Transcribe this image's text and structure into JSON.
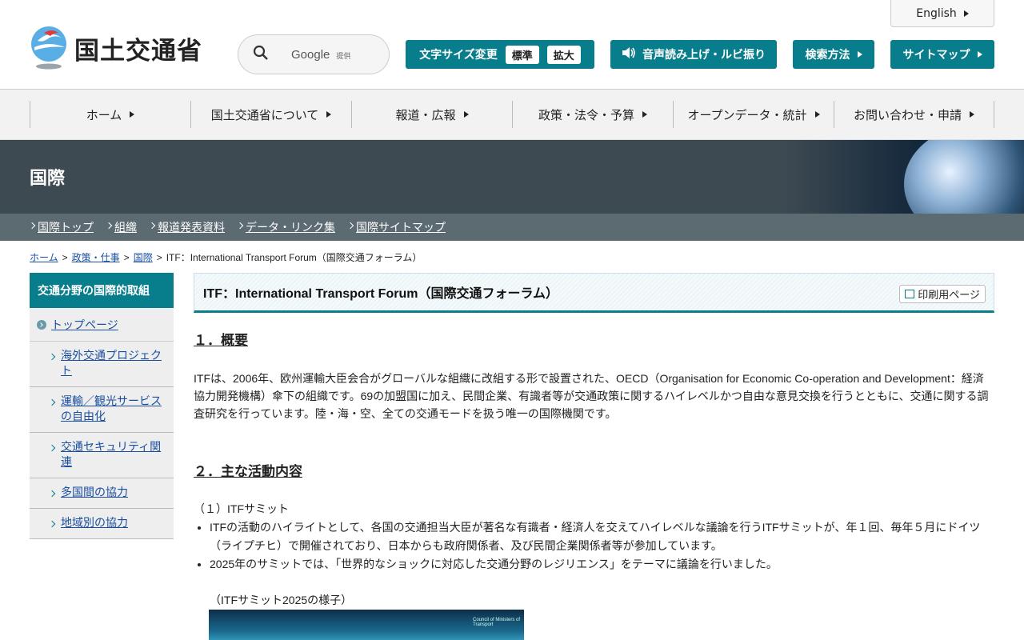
{
  "header": {
    "logo_text": "国土交通省",
    "search_brand": "Google",
    "search_suffix": "提供",
    "fontsize_label": "文字サイズ変更",
    "fontsize_normal": "標準",
    "fontsize_large": "拡大",
    "speech_label": "音声読み上げ・ルビ振り",
    "search_method": "検索方法",
    "sitemap": "サイトマップ",
    "english": "English"
  },
  "gnav": [
    {
      "label": "ホーム"
    },
    {
      "label": "国土交通省について"
    },
    {
      "label": "報道・広報"
    },
    {
      "label": "政策・法令・予算"
    },
    {
      "label": "オープンデータ・統計"
    },
    {
      "label": "お問い合わせ・申請"
    }
  ],
  "banner": {
    "title": "国際"
  },
  "subnav": [
    {
      "label": "国際トップ"
    },
    {
      "label": "組織"
    },
    {
      "label": "報道発表資料"
    },
    {
      "label": "データ・リンク集"
    },
    {
      "label": "国際サイトマップ"
    }
  ],
  "breadcrumb": {
    "home": "ホーム",
    "policy": "政策・仕事",
    "intl": "国際",
    "current": "ITF：International Transport Forum（国際交通フォーラム）",
    "sep": ">"
  },
  "sidebar": {
    "heading": "交通分野の国際的取組",
    "top": "トップページ",
    "items": [
      {
        "label": "海外交通プロジェクト"
      },
      {
        "label": "運輸／観光サービスの自由化"
      },
      {
        "label": "交通セキュリティ関連"
      },
      {
        "label": "多国間の協力"
      },
      {
        "label": "地域別の協力"
      }
    ]
  },
  "main": {
    "title": "ITF：International Transport Forum（国際交通フォーラム）",
    "print_label": "印刷用ページ",
    "section1": "１．概要",
    "overview": "ITFは、2006年、欧州運輸大臣会合がグローバルな組織に改組する形で設置された、OECD（Organisation for Economic Co-operation and Development：経済協力開発機構）傘下の組織です。69の加盟国に加え、民間企業、有識者等が交通政策に関するハイレベルかつ自由な意見交換を行うとともに、交通に関する調査研究を行っています。陸・海・空、全ての交通モードを扱う唯一の国際機関です。",
    "section2": "２．主な活動内容",
    "summit_head": "（１）ITFサミット",
    "bullets": [
      "ITFの活動のハイライトとして、各国の交通担当大臣が著名な有識者・経済人を交えてハイレベルな議論を行うITFサミットが、年１回、毎年５月にドイツ（ライプチヒ）で開催されており、日本からも政府関係者、及び民間企業関係者等が参加しています。",
      "2025年のサミットでは、「世界的なショックに対応した交通分野のレジリエンス」をテーマに議論を行いました。"
    ],
    "photo_caption": "（ITFサミット2025の様子）",
    "photo_sign": "Council of Ministers of Transport"
  },
  "colors": {
    "accent": "#087d8b",
    "banner": "#3e4a52",
    "subnav": "#5c6a72",
    "link": "#1a4fa0"
  }
}
